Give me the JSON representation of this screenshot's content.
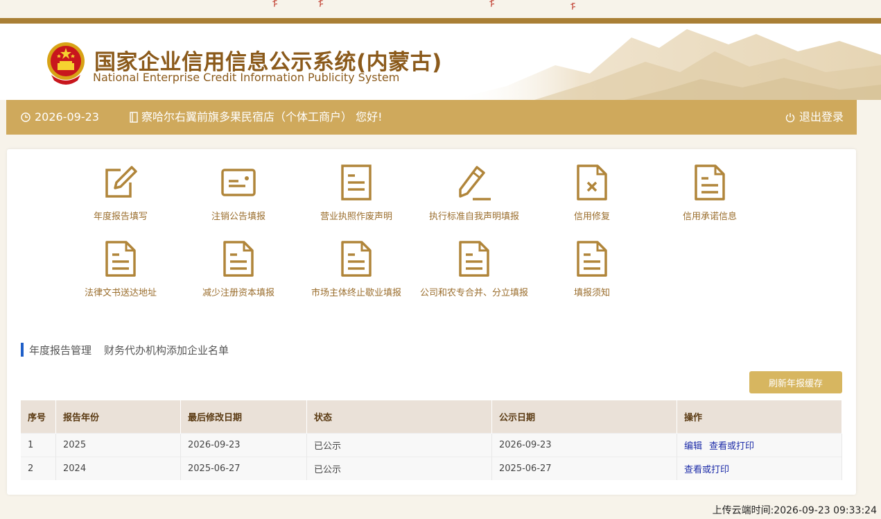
{
  "header": {
    "title_cn": "国家企业信用信息公示系统(内蒙古)",
    "title_en": "National Enterprise Credit Information Publicity System"
  },
  "navbar": {
    "date": "2026-09-23",
    "user_greeting": "察哈尔右翼前旗多果民宿店（个体工商户） 您好!",
    "logout": "退出登录"
  },
  "menu": [
    {
      "label": "年度报告填写",
      "icon": "edit-icon"
    },
    {
      "label": "注销公告填报",
      "icon": "card-icon"
    },
    {
      "label": "营业执照作废声明",
      "icon": "document-icon"
    },
    {
      "label": "执行标准自我声明填报",
      "icon": "pencil-icon"
    },
    {
      "label": "信用修复",
      "icon": "document-x-icon"
    },
    {
      "label": "信用承诺信息",
      "icon": "document-lines-icon"
    },
    {
      "label": "法律文书送达地址",
      "icon": "document-lines-icon"
    },
    {
      "label": "减少注册资本填报",
      "icon": "document-lines-icon"
    },
    {
      "label": "市场主体终止歇业填报",
      "icon": "document-lines-icon"
    },
    {
      "label": "公司和农专合并、分立填报",
      "icon": "document-lines-icon"
    },
    {
      "label": "填报须知",
      "icon": "document-lines-icon"
    }
  ],
  "tabs": [
    "年度报告管理",
    "财务代办机构添加企业名单"
  ],
  "refresh_button": "刷新年报缓存",
  "table": {
    "headers": [
      "序号",
      "报告年份",
      "最后修改日期",
      "状态",
      "公示日期",
      "操作"
    ],
    "rows": [
      {
        "no": "1",
        "year": "2025",
        "modified": "2026-09-23",
        "status": "已公示",
        "publish": "2026-09-23",
        "actions": [
          "编辑",
          "查看或打印"
        ]
      },
      {
        "no": "2",
        "year": "2024",
        "modified": "2025-06-27",
        "status": "已公示",
        "publish": "2025-06-27",
        "actions": [
          "查看或打印"
        ]
      }
    ]
  },
  "upload_time": "上传云端时间:2026-09-23 09:33:24",
  "colors": {
    "gold": "#cfa95c",
    "dark_gold": "#a97f35",
    "icon": "#b0853a",
    "link": "#1c2ba8",
    "tab_bar": "#1f5fc8"
  }
}
